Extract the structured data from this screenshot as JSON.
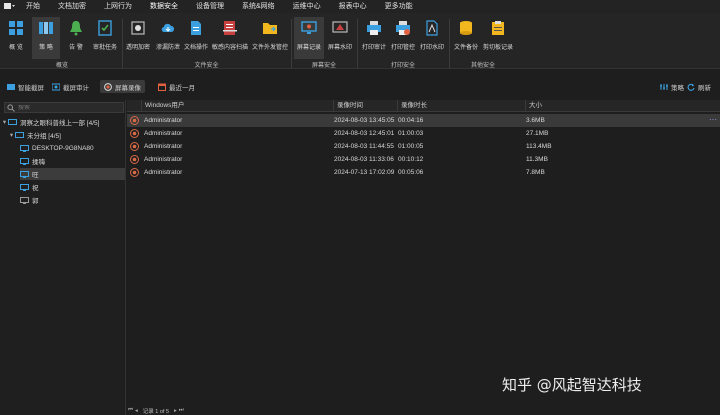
{
  "menubar": {
    "items": [
      "开始",
      "文档加密",
      "上网行为",
      "数据安全",
      "设备管理",
      "系统&网络",
      "运维中心",
      "报表中心",
      "更多功能"
    ],
    "active_index": 3
  },
  "ribbon": {
    "buttons": [
      "概 览",
      "策 略",
      "告 警",
      "审批任务",
      "透明加密",
      "文档操作",
      "敏感内容扫描",
      "文件外发管控",
      "屏幕记录",
      "屏幕水印",
      "打印审计",
      "打印管控",
      "打印水印",
      "文件备份",
      "剪切板记录"
    ],
    "button_icons": [
      "overview-icon",
      "policy-icon",
      "alert-bell-icon",
      "approval-task-icon",
      "encrypt-icon",
      "cloud-backup-icon",
      "document-icon",
      "scan-icon",
      "folder-icon",
      "screen-record-icon",
      "watermark-icon",
      "printer-icon",
      "print-control-icon",
      "print-watermark-icon",
      "backup-icon"
    ],
    "button_extra": "渗漏防泄",
    "groups": [
      "概览",
      "文件安全",
      "屏幕安全",
      "打印安全",
      "其他安全"
    ]
  },
  "subbar": {
    "smart_screenshot": "智能截屏",
    "screenshot_audit": "截屏审计",
    "screen_record": "屏幕录像",
    "recent_month": "最近一月",
    "filter": "策略",
    "refresh": "刷新"
  },
  "tree": {
    "search_placeholder": "搜索",
    "root": "洞察之眼科普线上一部  [4/5]",
    "group": "未分组  [4/5]",
    "nodes": [
      "DESKTOP-9G8NA80",
      "揉嗨",
      "旺",
      "祝",
      "郭"
    ]
  },
  "grid": {
    "columns": [
      "Windows用户",
      "录像时间",
      "录像时长",
      "大小"
    ],
    "rows": [
      {
        "user": "Administrator",
        "time": "2024-08-03 13:45:05",
        "duration": "00:04:16",
        "size": "3.6MB"
      },
      {
        "user": "Administrator",
        "time": "2024-08-03 12:45:01",
        "duration": "01:00:03",
        "size": "27.1MB"
      },
      {
        "user": "Administrator",
        "time": "2024-08-03 11:44:55",
        "duration": "01:00:05",
        "size": "113.4MB"
      },
      {
        "user": "Administrator",
        "time": "2024-08-03 11:33:06",
        "duration": "00:10:12",
        "size": "11.3MB"
      },
      {
        "user": "Administrator",
        "time": "2024-07-13 17:02:09",
        "duration": "00:05:06",
        "size": "7.8MB"
      }
    ],
    "more": "···"
  },
  "status": {
    "record_text": "记录 1 of 5"
  },
  "watermark": "知乎 @风起智达科技",
  "colors": {
    "accent": "#3ca0e0",
    "bell": "#4caf50",
    "folder": "#f2b71e",
    "record": "#e06040"
  }
}
